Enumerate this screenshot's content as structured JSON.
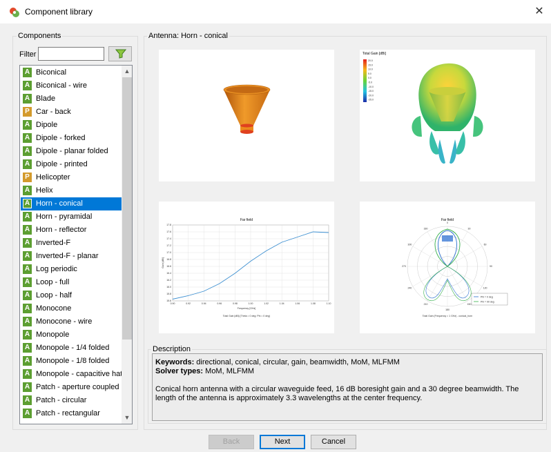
{
  "window": {
    "title": "Component library",
    "close_glyph": "✕"
  },
  "components_panel": {
    "group_label": "Components",
    "filter_label": "Filter",
    "filter_value": "",
    "filter_icon": "funnel-icon",
    "items": [
      {
        "badge": "A",
        "label": "Biconical"
      },
      {
        "badge": "A",
        "label": "Biconical - wire"
      },
      {
        "badge": "A",
        "label": "Blade"
      },
      {
        "badge": "P",
        "label": "Car - back"
      },
      {
        "badge": "A",
        "label": "Dipole"
      },
      {
        "badge": "A",
        "label": "Dipole - forked"
      },
      {
        "badge": "A",
        "label": "Dipole - planar folded"
      },
      {
        "badge": "A",
        "label": "Dipole - printed"
      },
      {
        "badge": "P",
        "label": "Helicopter"
      },
      {
        "badge": "A",
        "label": "Helix"
      },
      {
        "badge": "A",
        "label": "Horn - conical",
        "selected": true
      },
      {
        "badge": "A",
        "label": "Horn - pyramidal"
      },
      {
        "badge": "A",
        "label": "Horn - reflector"
      },
      {
        "badge": "A",
        "label": "Inverted-F"
      },
      {
        "badge": "A",
        "label": "Inverted-F - planar"
      },
      {
        "badge": "A",
        "label": "Log periodic"
      },
      {
        "badge": "A",
        "label": "Loop - full"
      },
      {
        "badge": "A",
        "label": "Loop - half"
      },
      {
        "badge": "A",
        "label": "Monocone"
      },
      {
        "badge": "A",
        "label": "Monocone - wire"
      },
      {
        "badge": "A",
        "label": "Monopole"
      },
      {
        "badge": "A",
        "label": "Monopole - 1/4 folded"
      },
      {
        "badge": "A",
        "label": "Monopole - 1/8 folded"
      },
      {
        "badge": "A",
        "label": "Monopole - capacitive hat"
      },
      {
        "badge": "A",
        "label": "Patch - aperture coupled"
      },
      {
        "badge": "A",
        "label": "Patch - circular"
      },
      {
        "badge": "A",
        "label": "Patch - rectangular"
      }
    ]
  },
  "preview": {
    "group_label": "Antenna: Horn - conical",
    "gain_legend_title": "Total Gain [dBi]",
    "gain_legend_values": [
      "20.0",
      "15.0",
      "10.0",
      "5.0",
      "0.0",
      "-5.0",
      "-10.0",
      "-15.0",
      "-20.0",
      "-25.0"
    ],
    "cartesian_title": "Far field",
    "cartesian_xlabel": "Frequency [GHz]",
    "cartesian_ylabel": "Gain [dBi]",
    "cartesian_caption": "Total Gain [dBi] (Theta = 0 deg; Phi = 0 deg)",
    "polar_title": "Far field",
    "polar_caption": "Total Gain (Frequency = 1 GHz) - conical_horn",
    "polar_legend": [
      "Phi = 0 deg",
      "Phi = 90 deg"
    ]
  },
  "chart_data": [
    {
      "type": "line",
      "title": "Far field",
      "xlabel": "Frequency [GHz]",
      "ylabel": "Gain [dBi]",
      "x": [
        0.9,
        0.92,
        0.94,
        0.96,
        0.98,
        1.0,
        1.02,
        1.04,
        1.06,
        1.08,
        1.1
      ],
      "x_ticks": [
        "0.90",
        "0.92",
        "0.94",
        "0.96",
        "0.98",
        "1.00",
        "1.02",
        "1.04",
        "1.06",
        "1.08",
        "1.10"
      ],
      "y_ticks": [
        "15.6",
        "15.8",
        "16.0",
        "16.2",
        "16.4",
        "16.6",
        "16.8",
        "17.0",
        "17.2",
        "17.4",
        "17.6",
        "17.8"
      ],
      "series": [
        {
          "values": [
            15.65,
            15.75,
            15.88,
            16.1,
            16.4,
            16.75,
            17.05,
            17.3,
            17.45,
            17.6,
            17.58
          ]
        }
      ],
      "ylim": [
        15.6,
        17.8
      ],
      "grid": true,
      "color": "#3c8fd1"
    },
    {
      "type": "polar",
      "title": "Far field",
      "angle_ticks": [
        "0",
        "30",
        "60",
        "90",
        "120",
        "150",
        "180",
        "210",
        "240",
        "270",
        "300",
        "330"
      ],
      "series": [
        {
          "name": "Phi = 0 deg",
          "color": "#2a6fcf"
        },
        {
          "name": "Phi = 90 deg",
          "color": "#35b04a"
        }
      ],
      "legend_position": "bottom-right"
    }
  ],
  "description": {
    "group_label": "Description",
    "keywords_label": "Keywords:",
    "keywords": " directional, conical, circular, gain, beamwidth, MoM, MLFMM",
    "solver_label": "Solver types:",
    "solvers": " MoM, MLFMM",
    "text": "Conical horn antenna with a circular waveguide feed, 16 dB boresight gain and a 30 degree beamwidth. The length of the antenna is approximately 3.3 wavelengths at the center frequency."
  },
  "buttons": {
    "back": "Back",
    "next": "Next",
    "cancel": "Cancel"
  },
  "colors": {
    "accent": "#0078d7",
    "badge_antenna": "#5c9e31",
    "badge_platform": "#d39a2c"
  }
}
